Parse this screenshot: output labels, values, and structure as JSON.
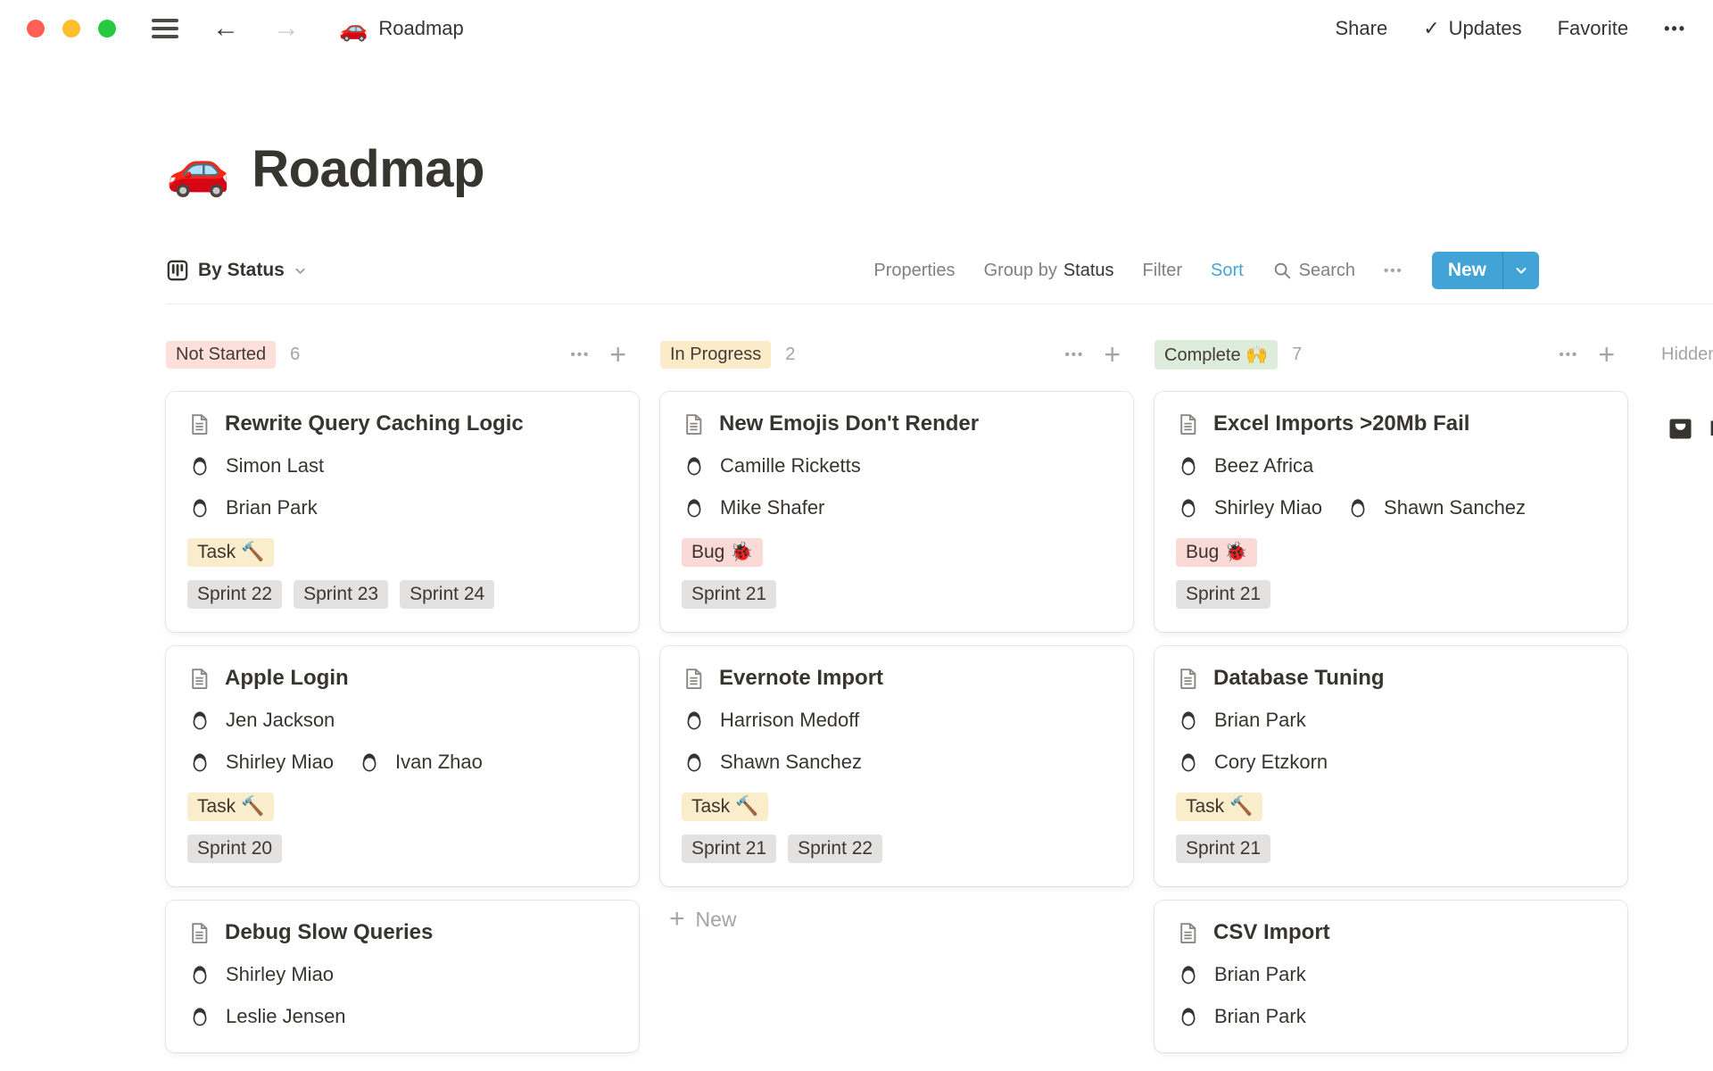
{
  "topbar": {
    "breadcrumb": {
      "icon": "🚗",
      "title": "Roadmap"
    },
    "actions": {
      "share": "Share",
      "updates": "Updates",
      "favorite": "Favorite",
      "more": "•••"
    },
    "icons": {
      "back_arrow": "←",
      "forward_arrow": "→",
      "updates_check": "✓"
    }
  },
  "page": {
    "icon": "🚗",
    "title": "Roadmap"
  },
  "toolbar": {
    "view_label": "By Status",
    "properties": "Properties",
    "group_by_label": "Group by",
    "group_by_value": "Status",
    "filter": "Filter",
    "sort": "Sort",
    "search": "Search",
    "more": "•••",
    "new_button": "New"
  },
  "colors": {
    "accent_blue": "#42A4D6",
    "not_started_bg": "#FFDFDA",
    "in_progress_bg": "#FBEBC8",
    "complete_bg": "#DEECDC",
    "tag_task_bg": "#FAEDCC",
    "tag_bug_bg": "#FBD9D6",
    "sprint_bg": "#E3E2E0"
  },
  "board": {
    "columns": [
      {
        "id": "not-started",
        "label": "Not Started",
        "count": "6",
        "pill_bg": "#FFDFDA",
        "cards": [
          {
            "title": "Rewrite Query Caching Logic",
            "people_rows": [
              [
                "Simon Last"
              ],
              [
                "Brian Park"
              ]
            ],
            "tag": {
              "label": "Task 🔨",
              "type": "task"
            },
            "sprints": [
              "Sprint 22",
              "Sprint 23",
              "Sprint 24"
            ]
          },
          {
            "title": "Apple Login",
            "people_rows": [
              [
                "Jen Jackson"
              ],
              [
                "Shirley Miao",
                "Ivan Zhao"
              ]
            ],
            "tag": {
              "label": "Task 🔨",
              "type": "task"
            },
            "sprints": [
              "Sprint 20"
            ]
          },
          {
            "title": "Debug Slow Queries",
            "people_rows": [
              [
                "Shirley Miao"
              ],
              [
                "Leslie Jensen"
              ]
            ]
          }
        ]
      },
      {
        "id": "in-progress",
        "label": "In Progress",
        "count": "2",
        "pill_bg": "#FBEBC8",
        "cards": [
          {
            "title": "New Emojis Don't Render",
            "people_rows": [
              [
                "Camille Ricketts"
              ],
              [
                "Mike Shafer"
              ]
            ],
            "tag": {
              "label": "Bug 🐞",
              "type": "bug"
            },
            "sprints": [
              "Sprint 21"
            ]
          },
          {
            "title": "Evernote Import",
            "people_rows": [
              [
                "Harrison Medoff"
              ],
              [
                "Shawn Sanchez"
              ]
            ],
            "tag": {
              "label": "Task 🔨",
              "type": "task"
            },
            "sprints": [
              "Sprint 21",
              "Sprint 22"
            ]
          }
        ],
        "new_label": "New"
      },
      {
        "id": "complete",
        "label": "Complete 🙌",
        "count": "7",
        "pill_bg": "#DEECDC",
        "cards": [
          {
            "title": "Excel Imports >20Mb Fail",
            "people_rows": [
              [
                "Beez Africa"
              ],
              [
                "Shirley Miao",
                "Shawn Sanchez"
              ]
            ],
            "tag": {
              "label": "Bug 🐞",
              "type": "bug"
            },
            "sprints": [
              "Sprint 21"
            ]
          },
          {
            "title": "Database Tuning",
            "people_rows": [
              [
                "Brian Park"
              ],
              [
                "Cory Etzkorn"
              ]
            ],
            "tag": {
              "label": "Task 🔨",
              "type": "task"
            },
            "sprints": [
              "Sprint 21"
            ]
          },
          {
            "title": "CSV Import",
            "people_rows": [
              [
                "Brian Park"
              ],
              [
                "Brian Park"
              ]
            ]
          }
        ]
      }
    ],
    "hidden": {
      "label": "Hidden",
      "item": "N"
    }
  }
}
